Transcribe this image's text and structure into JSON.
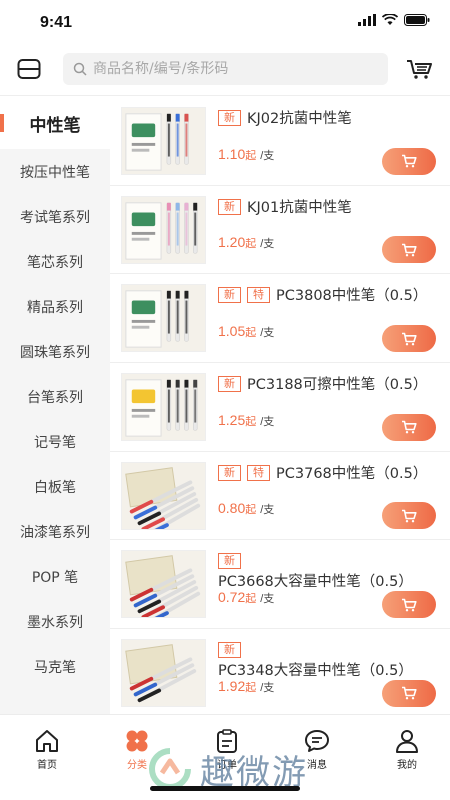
{
  "status": {
    "time": "9:41"
  },
  "search": {
    "placeholder": "商品名称/编号/条形码"
  },
  "categories": [
    {
      "label": "中性笔",
      "active": true
    },
    {
      "label": "按压中性笔"
    },
    {
      "label": "考试笔系列"
    },
    {
      "label": "笔芯系列"
    },
    {
      "label": "精品系列"
    },
    {
      "label": "圆珠笔系列"
    },
    {
      "label": "台笔系列"
    },
    {
      "label": "记号笔"
    },
    {
      "label": "白板笔"
    },
    {
      "label": "油漆笔系列"
    },
    {
      "label": "POP 笔"
    },
    {
      "label": "墨水系列"
    },
    {
      "label": "马克笔"
    }
  ],
  "products": [
    {
      "tags": [
        "新"
      ],
      "title": "KJ02抗菌中性笔",
      "price": "1.10",
      "suffix": "起",
      "unit": "/支"
    },
    {
      "tags": [
        "新"
      ],
      "title": "KJ01抗菌中性笔",
      "price": "1.20",
      "suffix": "起",
      "unit": "/支"
    },
    {
      "tags": [
        "新",
        "特"
      ],
      "title": "PC3808中性笔（0.5）",
      "price": "1.05",
      "suffix": "起",
      "unit": "/支"
    },
    {
      "tags": [
        "新"
      ],
      "title": "PC3188可擦中性笔（0.5）",
      "price": "1.25",
      "suffix": "起",
      "unit": "/支"
    },
    {
      "tags": [
        "新",
        "特"
      ],
      "title": "PC3768中性笔（0.5）",
      "price": "0.80",
      "suffix": "起",
      "unit": "/支"
    },
    {
      "tags": [
        "新"
      ],
      "title": "PC3668大容量中性笔（0.5）",
      "price": "0.72",
      "suffix": "起",
      "unit": "/支"
    },
    {
      "tags": [
        "新"
      ],
      "title": "PC3348大容量中性笔（0.5）",
      "price": "1.92",
      "suffix": "起",
      "unit": "/支"
    }
  ],
  "tabbar": {
    "home": "首页",
    "category": "分类",
    "orders": "订单",
    "messages": "消息",
    "mine": "我的"
  },
  "watermark": {
    "text": "趣微游"
  },
  "colors": {
    "accent": "#f0714a",
    "sidebar_bg": "#f5f5f5"
  }
}
